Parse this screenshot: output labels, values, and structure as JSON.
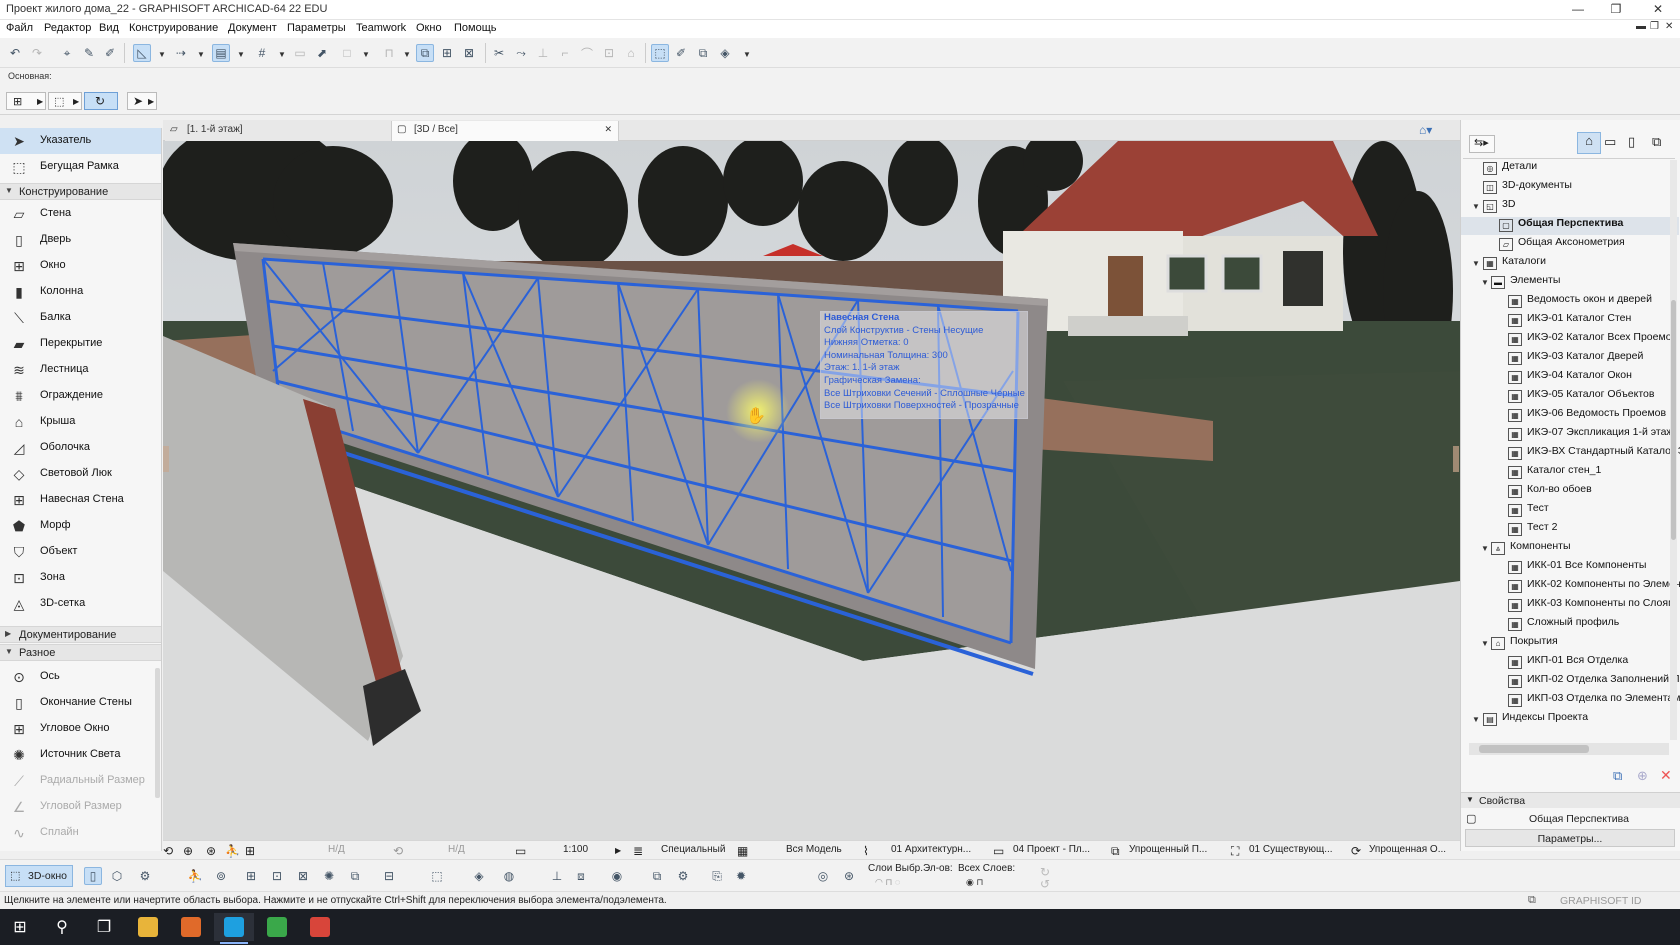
{
  "window": {
    "title": "Проект жилого дома_22 - GRAPHISOFT ARCHICAD-64 22 EDU",
    "minimize": "—",
    "maximize": "❐",
    "close": "✕"
  },
  "menu": [
    "Файл",
    "Редактор",
    "Вид",
    "Конструирование",
    "Документ",
    "Параметры",
    "Teamwork",
    "Окно",
    "Помощь"
  ],
  "infobox": {
    "label": "Основная:"
  },
  "toolbox": {
    "pointer": "Указатель",
    "marquee": "Бегущая Рамка",
    "group_design": "Конструирование",
    "design_tools": [
      "Стена",
      "Дверь",
      "Окно",
      "Колонна",
      "Балка",
      "Перекрытие",
      "Лестница",
      "Ограждение",
      "Крыша",
      "Оболочка",
      "Световой Люк",
      "Навесная Стена",
      "Морф",
      "Объект",
      "Зона",
      "3D-сетка"
    ],
    "group_document": "Документирование",
    "group_misc": "Разное",
    "misc_tools": [
      "Ось",
      "Окончание Стены",
      "Угловое Окно",
      "Источник Света",
      "Радиальный Размер",
      "Угловой Размер",
      "Сплайн"
    ]
  },
  "tabs": [
    {
      "label": "[1. 1-й этаж]"
    },
    {
      "label": "[3D / Все]",
      "close": "✕"
    }
  ],
  "tooltip": {
    "title": "Навесная Стена",
    "lines": [
      "Слой Конструктив - Стены Несущие",
      "Нижняя Отметка: 0",
      "Номинальная Толщина: 300",
      "Этаж: 1. 1-й этаж",
      "Графическая Замена:",
      "Все Штриховки Сечений - Сплошные Черные",
      "Все Штриховки Поверхностей - Прозрачные"
    ]
  },
  "navigator": {
    "items": [
      {
        "label": "Детали",
        "indent": 0
      },
      {
        "label": "3D-документы",
        "indent": 0
      },
      {
        "label": "3D",
        "indent": 0,
        "open": true
      },
      {
        "label": "Общая Перспектива",
        "indent": 1,
        "selected": true
      },
      {
        "label": "Общая Аксонометрия",
        "indent": 1
      },
      {
        "label": "Каталоги",
        "indent": 0,
        "open": true
      },
      {
        "label": "Элементы",
        "indent": 1,
        "open": true
      },
      {
        "label": "Ведомость окон и дверей",
        "indent": 2
      },
      {
        "label": "ИКЭ-01 Каталог Стен",
        "indent": 2
      },
      {
        "label": "ИКЭ-02 Каталог Всех Проемов",
        "indent": 2
      },
      {
        "label": "ИКЭ-03 Каталог Дверей",
        "indent": 2
      },
      {
        "label": "ИКЭ-04 Каталог Окон",
        "indent": 2
      },
      {
        "label": "ИКЭ-05 Каталог Объектов",
        "indent": 2
      },
      {
        "label": "ИКЭ-06 Ведомость Проемов",
        "indent": 2
      },
      {
        "label": "ИКЭ-07 Экспликация 1-й этаж",
        "indent": 2
      },
      {
        "label": "ИКЭ-ВХ Стандартный Каталог Э",
        "indent": 2
      },
      {
        "label": "Каталог стен_1",
        "indent": 2
      },
      {
        "label": "Кол-во обоев",
        "indent": 2
      },
      {
        "label": "Тест",
        "indent": 2
      },
      {
        "label": "Тест 2",
        "indent": 2
      },
      {
        "label": "Компоненты",
        "indent": 1,
        "open": true
      },
      {
        "label": "ИКК-01 Все Компоненты",
        "indent": 2
      },
      {
        "label": "ИКК-02 Компоненты по Элемен",
        "indent": 2
      },
      {
        "label": "ИКК-03 Компоненты по Слоям",
        "indent": 2
      },
      {
        "label": "Сложный профиль",
        "indent": 2
      },
      {
        "label": "Покрытия",
        "indent": 1,
        "open": true
      },
      {
        "label": "ИКП-01 Вся Отделка",
        "indent": 2
      },
      {
        "label": "ИКП-02 Отделка Заполнений П",
        "indent": 2
      },
      {
        "label": "ИКП-03 Отделка по Элементам",
        "indent": 2
      },
      {
        "label": "Индексы Проекта",
        "indent": 0,
        "open": true
      }
    ],
    "properties_title": "Свойства",
    "properties_value": "Общая Перспектива",
    "params_button": "Параметры..."
  },
  "viewbar": {
    "nd1": "Н/Д",
    "nd2": "Н/Д",
    "scale": "1:100",
    "special": "Специальный",
    "model": "Вся Модель",
    "layer": "01 Архитектурн...",
    "project": "04 Проект - Пл...",
    "simplified1": "Упрощенный П...",
    "existing": "01 Существующ...",
    "simplified2": "Упрощенная О..."
  },
  "bottombar": {
    "button_3d": "3D-окно",
    "layers_sel": "Слои Выбр.Эл-ов:",
    "all_layers": "Всех Слоев:"
  },
  "status": {
    "text": "Щелкните на элементе или начертите область выбора. Нажмите и не отпускайте Ctrl+Shift для переключения выбора элемента/подэлемента.",
    "brand": "GRAPHISOFT ID"
  },
  "colors": {
    "accent": "#2a62d8",
    "selection": "#cfe1f3",
    "grass": "#3c4a3a",
    "roof": "#9b4136"
  }
}
